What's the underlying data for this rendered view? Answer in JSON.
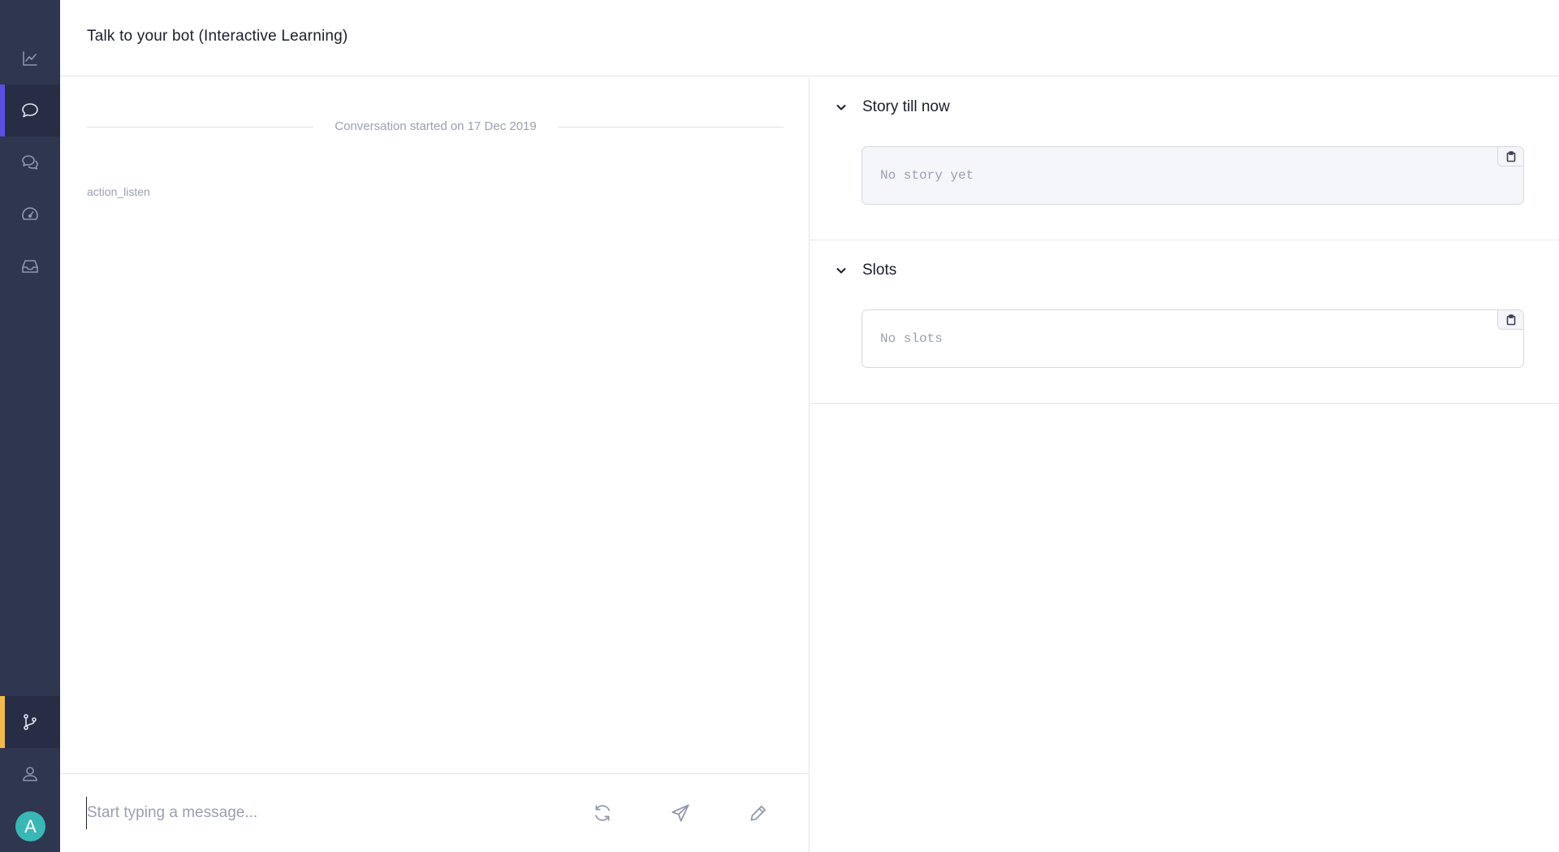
{
  "header": {
    "title": "Talk to your bot (Interactive Learning)"
  },
  "sidebar": {
    "items": [
      {
        "icon": "chart-icon",
        "active": false
      },
      {
        "icon": "chat-bubble-icon",
        "active": true,
        "accent": "#5a4fe0"
      },
      {
        "icon": "conversations-icon",
        "active": false
      },
      {
        "icon": "dashboard-gauge-icon",
        "active": false
      },
      {
        "icon": "inbox-icon",
        "active": false
      },
      {
        "icon": "git-branch-icon",
        "active": true,
        "accent": "#f2b94d"
      },
      {
        "icon": "user-icon",
        "active": false
      }
    ],
    "avatar": {
      "initial": "A",
      "color": "#3ab7b5"
    }
  },
  "chat": {
    "divider_text": "Conversation started on 17 Dec 2019",
    "action_label": "action_listen",
    "composer": {
      "placeholder": "Start typing a message...",
      "buttons": [
        "refresh-icon",
        "send-icon",
        "pen-icon"
      ]
    }
  },
  "panels": {
    "story": {
      "title": "Story till now",
      "content": "No story yet"
    },
    "slots": {
      "title": "Slots",
      "content": "No slots"
    }
  }
}
